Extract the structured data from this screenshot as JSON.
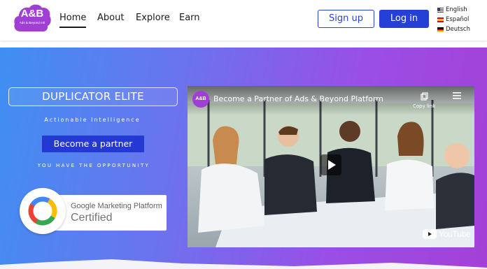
{
  "brand": {
    "logo_title": "A&B",
    "logo_sub": "Ads & Beyond Intl",
    "color": "#a03fd4"
  },
  "nav": {
    "items": [
      {
        "label": "Home",
        "active": true
      },
      {
        "label": "About"
      },
      {
        "label": "Explore"
      },
      {
        "label": "Earn"
      }
    ]
  },
  "auth": {
    "signup_label": "Sign up",
    "login_label": "Log in",
    "accent": "#2540d6"
  },
  "languages": [
    {
      "label": "English",
      "flag": "us-flag-icon"
    },
    {
      "label": "Español",
      "flag": "spain-flag-icon"
    },
    {
      "label": "Deutsch",
      "flag": "germany-flag-icon"
    }
  ],
  "hero": {
    "title": "DUPLICATOR ELITE",
    "tagline": "Actionable Intelligence",
    "cta_label": "Become a partner",
    "subtext": "YOU HAVE THE OPPORTUNITY"
  },
  "badge": {
    "line1_brand": "Google",
    "line1_rest": " Marketing Platform",
    "line2": "Certified"
  },
  "video": {
    "channel_avatar": "A&B",
    "title": "Become a Partner of Ads & Beyond Platform",
    "copy_label": "Copy link",
    "youtube_label": "YouTube"
  }
}
